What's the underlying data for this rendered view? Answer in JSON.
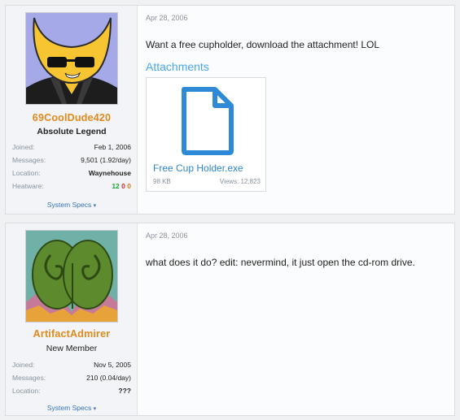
{
  "posts": [
    {
      "user": {
        "name": "69CoolDude420",
        "title": "Absolute Legend",
        "stats": {
          "joined_label": "Joined:",
          "joined": "Feb 1, 2006",
          "messages_label": "Messages:",
          "messages": "9,501 (1.92/day)",
          "location_label": "Location:",
          "location": "Waynehouse",
          "heatware_label": "Heatware:",
          "heatware": {
            "positive": "12",
            "neutral": "0",
            "negative": "0"
          }
        },
        "system_specs": "System Specs"
      },
      "date": "Apr 28, 2006",
      "message": "Want a free cupholder, download the attachment! LOL",
      "attachments_title": "Attachments",
      "attachment": {
        "name": "Free Cup Holder.exe",
        "size": "98 KB",
        "views": "Views: 12,823"
      }
    },
    {
      "user": {
        "name": "ArtifactAdmirer",
        "title": "New Member",
        "stats": {
          "joined_label": "Joined:",
          "joined": "Nov 5, 2005",
          "messages_label": "Messages:",
          "messages": "210 (0.04/day)",
          "location_label": "Location:",
          "location": "???"
        },
        "system_specs": "System Specs"
      },
      "date": "Apr 28, 2006",
      "message": "what does it do? edit: nevermind, it just open the cd-rom drive."
    }
  ],
  "colors": {
    "username": "#e08a1c",
    "link": "#3a74b8",
    "attachments_title": "#47a7eb",
    "heat_positive": "#1aa13a",
    "heat_neutral": "#d43030",
    "heat_negative": "#e07a1a"
  },
  "icons": {
    "chevron": "chevron-down-icon",
    "file": "file-icon"
  }
}
